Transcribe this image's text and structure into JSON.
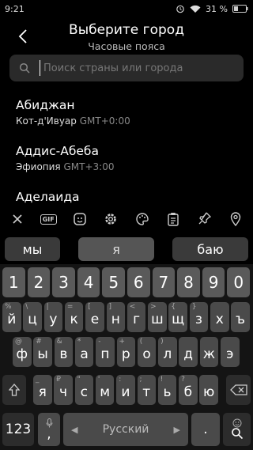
{
  "status": {
    "time": "9:21",
    "battery": "31 %"
  },
  "header": {
    "title": "Выберите город",
    "subtitle": "Часовые пояса"
  },
  "search": {
    "placeholder": "Поиск страны или города"
  },
  "cities": [
    {
      "name": "Абиджан",
      "country": "Кот-д'Ивуар",
      "gmt": "GMT+0:00"
    },
    {
      "name": "Аддис-Абеба",
      "country": "Эфиопия",
      "gmt": "GMT+3:00"
    },
    {
      "name": "Аделаида",
      "country": "",
      "gmt": ""
    }
  ],
  "toolbar": {
    "icons": [
      "close-icon",
      "gif-icon",
      "sticker-icon",
      "settings-icon",
      "theme-palette-icon",
      "clipboard-icon",
      "pin-icon",
      "location-icon"
    ],
    "gif_label": "GIF"
  },
  "suggestions": {
    "left": "мы",
    "middle": "я",
    "right": "баю"
  },
  "keyboard": {
    "numbers": [
      "1",
      "2",
      "3",
      "4",
      "5",
      "6",
      "7",
      "8",
      "9",
      "0"
    ],
    "row1": [
      {
        "k": "й",
        "h": "%"
      },
      {
        "k": "ц",
        "h": "\\"
      },
      {
        "k": "у",
        "h": "|"
      },
      {
        "k": "к",
        "h": "="
      },
      {
        "k": "е",
        "h": "["
      },
      {
        "k": "н",
        "h": "]"
      },
      {
        "k": "г",
        "h": "<"
      },
      {
        "k": "ш",
        "h": ">"
      },
      {
        "k": "щ",
        "h": "{"
      },
      {
        "k": "з",
        "h": "}"
      },
      {
        "k": "х",
        "h": ""
      },
      {
        "k": "ъ",
        "h": ""
      }
    ],
    "row2": [
      {
        "k": "ф",
        "h": "@"
      },
      {
        "k": "ы",
        "h": "#"
      },
      {
        "k": "в",
        "h": "&"
      },
      {
        "k": "а",
        "h": "*"
      },
      {
        "k": "п",
        "h": "-"
      },
      {
        "k": "р",
        "h": "+"
      },
      {
        "k": "о",
        "h": "("
      },
      {
        "k": "л",
        "h": ")"
      },
      {
        "k": "д",
        "h": ""
      },
      {
        "k": "ж",
        "h": ""
      },
      {
        "k": "э",
        "h": ""
      }
    ],
    "row3": [
      {
        "k": "я",
        "h": "_"
      },
      {
        "k": "ч",
        "h": "₽"
      },
      {
        "k": "с",
        "h": "\""
      },
      {
        "k": "м",
        "h": "'"
      },
      {
        "k": "и",
        "h": ":"
      },
      {
        "k": "т",
        "h": ";"
      },
      {
        "k": "ь",
        "h": "!"
      },
      {
        "k": "б",
        "h": "?"
      },
      {
        "k": "ю",
        "h": ""
      }
    ],
    "numbers_key": "123",
    "space_label": "Русский",
    "period": "."
  }
}
